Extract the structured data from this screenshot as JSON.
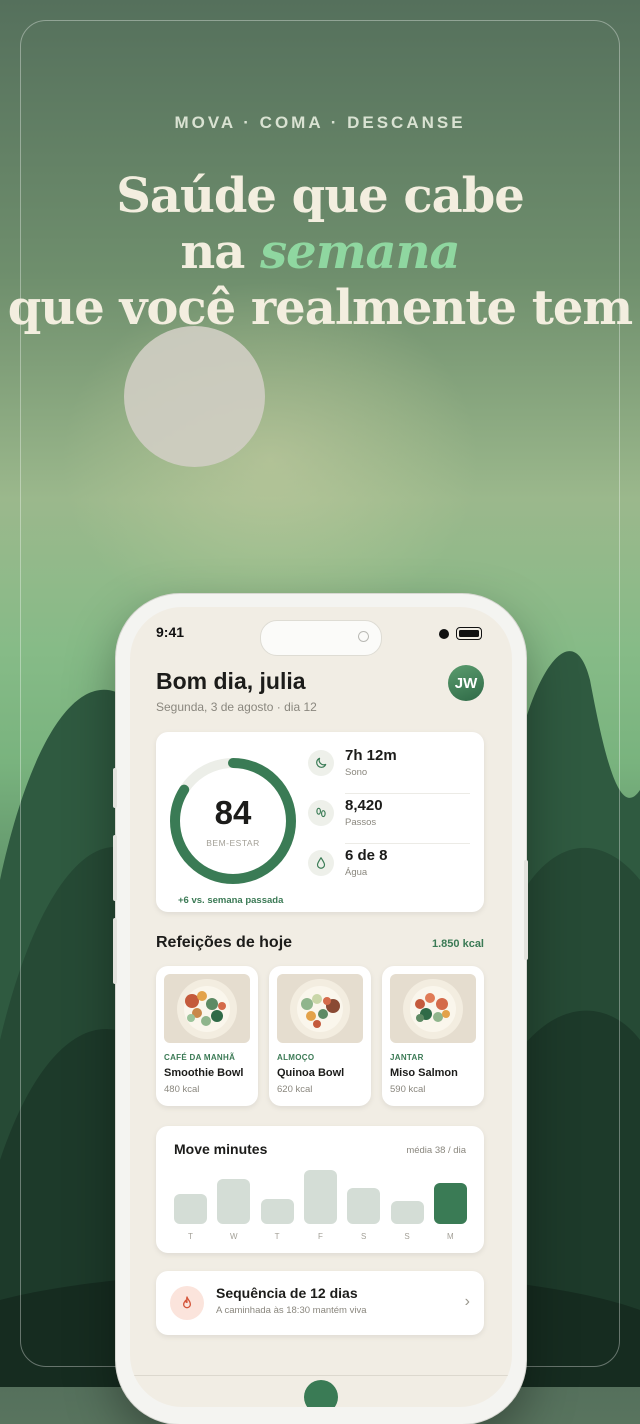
{
  "poster": {
    "eyebrow": "MOVA · COMA · DESCANSE",
    "headline_line1": "Saúde que cabe",
    "headline_line2_pre": "na ",
    "headline_line2_accent": "semana",
    "headline_line3": "que você realmente tem"
  },
  "status_bar": {
    "time": "9:41"
  },
  "header": {
    "greeting": "Bom dia, julia",
    "date": "Segunda, 3 de agosto · dia 12",
    "avatar_initials": "JW"
  },
  "wellness": {
    "score": "84",
    "score_label": "BEM-ESTAR",
    "score_fraction": 0.84,
    "delta": "+6 vs. semana passada",
    "metrics": [
      {
        "icon": "moon-icon",
        "value": "7h 12m",
        "label": "Sono"
      },
      {
        "icon": "footprints-icon",
        "value": "8,420",
        "label": "Passos"
      },
      {
        "icon": "water-drop-icon",
        "value": "6 de 8",
        "label": "Água"
      }
    ]
  },
  "meals": {
    "title": "Refeições de hoje",
    "total_kcal": "1.850 kcal",
    "items": [
      {
        "category": "CAFÉ DA MANHÃ",
        "name": "Smoothie Bowl",
        "kcal": "480 kcal"
      },
      {
        "category": "ALMOÇO",
        "name": "Quinoa Bowl",
        "kcal": "620 kcal"
      },
      {
        "category": "JANTAR",
        "name": "Miso Salmon",
        "kcal": "590 kcal"
      }
    ]
  },
  "move": {
    "title": "Move minutes",
    "average": "média 38 / dia",
    "days": [
      "T",
      "W",
      "T",
      "F",
      "S",
      "S",
      "M"
    ],
    "values": [
      30,
      45,
      25,
      54,
      36,
      23,
      41
    ],
    "active_index": 6
  },
  "streak": {
    "title": "Sequência de 12 dias",
    "subtitle": "A caminhada às 18:30 mantém viva"
  },
  "colors": {
    "accent": "#3a7b55",
    "bar_inactive": "#d4ddd6",
    "background": "#f1ede4"
  }
}
